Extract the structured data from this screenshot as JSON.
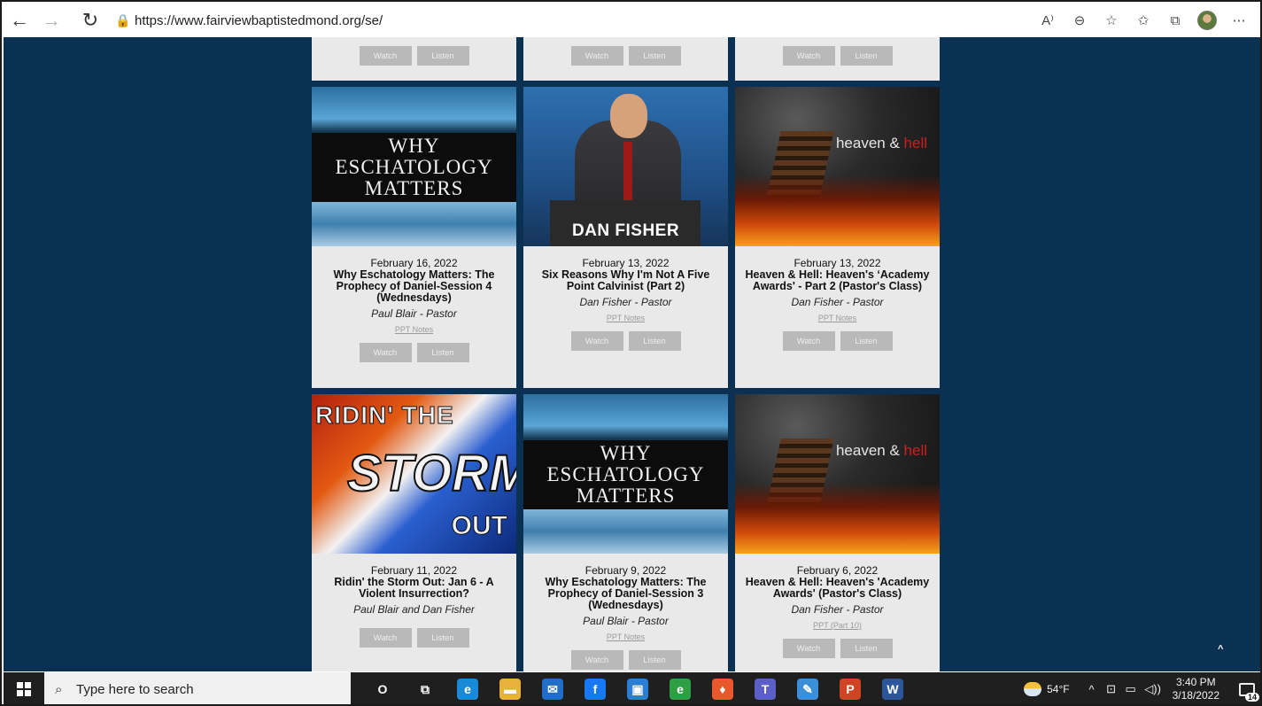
{
  "browser": {
    "url": "https://www.fairviewbaptistedmond.org/se/",
    "back_icon": "←",
    "forward_icon": "→",
    "refresh_icon": "↻",
    "lock_icon": "🔒",
    "toolbar_icons": [
      "read-aloud-icon",
      "zoom-icon",
      "add-favorite-icon",
      "favorites-icon",
      "collections-icon",
      "profile-icon",
      "more-icon"
    ],
    "read_aloud_glyph": "A⁾",
    "zoom_glyph": "⊖",
    "add_favorite_glyph": "☆",
    "favorites_glyph": "✩",
    "collections_glyph": "⧉",
    "more_glyph": "⋯"
  },
  "page": {
    "watch_label": "Watch",
    "listen_label": "Listen",
    "scroll_top_glyph": "^",
    "sermons": [
      {
        "thumb": "why-eschatology-matters",
        "thumb_text": [
          "WHY",
          "ESCHATOLOGY",
          "MATTERS"
        ],
        "date": "February 16, 2022",
        "title": "Why Eschatology Matters: The Prophecy of Daniel-Session 4 (Wednesdays)",
        "speaker": "Paul Blair - Pastor",
        "notes": "PPT Notes"
      },
      {
        "thumb": "dan-fisher",
        "thumb_text": [
          "DAN FISHER"
        ],
        "date": "February 13, 2022",
        "title": "Six Reasons Why I'm Not A Five Point Calvinist (Part 2)",
        "speaker": "Dan Fisher - Pastor",
        "notes": "PPT Notes"
      },
      {
        "thumb": "heaven-and-hell",
        "thumb_text": [
          "heaven &",
          "hell"
        ],
        "date": "February 13, 2022",
        "title": "Heaven & Hell: Heaven's ‘Academy Awards' - Part 2 (Pastor's Class)",
        "speaker": "Dan Fisher - Pastor",
        "notes": "PPT Notes"
      },
      {
        "thumb": "ridin-the-storm-out",
        "thumb_text": [
          "RIDIN' THE",
          "STORM",
          "OUT"
        ],
        "date": "February 11, 2022",
        "title": "Ridin' the Storm Out: Jan 6 - A Violent Insurrection?",
        "speaker": "Paul Blair and Dan Fisher",
        "notes": ""
      },
      {
        "thumb": "why-eschatology-matters",
        "thumb_text": [
          "WHY",
          "ESCHATOLOGY",
          "MATTERS"
        ],
        "date": "February 9, 2022",
        "title": "Why Eschatology Matters: The Prophecy of Daniel-Session 3 (Wednesdays)",
        "speaker": "Paul Blair - Pastor",
        "notes": "PPT Notes"
      },
      {
        "thumb": "heaven-and-hell",
        "thumb_text": [
          "heaven &",
          "hell"
        ],
        "date": "February 6, 2022",
        "title": "Heaven & Hell: Heaven's 'Academy Awards' (Pastor's Class)",
        "speaker": "Dan Fisher - Pastor",
        "notes": "PPT (Part 10)"
      }
    ]
  },
  "taskbar": {
    "search_placeholder": "Type here to search",
    "search_glyph": "⌕",
    "apps": [
      {
        "name": "cortana-icon",
        "glyph": "O",
        "color": "#1f1f1f"
      },
      {
        "name": "task-view-icon",
        "glyph": "⧉",
        "color": "#1f1f1f"
      },
      {
        "name": "edge-icon",
        "glyph": "e",
        "color": "#1a8ad6"
      },
      {
        "name": "file-explorer-icon",
        "glyph": "▬",
        "color": "#e8b13a"
      },
      {
        "name": "mail-icon",
        "glyph": "✉",
        "color": "#1f6fc9"
      },
      {
        "name": "facebook-icon",
        "glyph": "f",
        "color": "#1877f2"
      },
      {
        "name": "store-icon",
        "glyph": "▣",
        "color": "#2a7fd4"
      },
      {
        "name": "edge-dev-icon",
        "glyph": "e",
        "color": "#2ea043"
      },
      {
        "name": "brave-icon",
        "glyph": "♦",
        "color": "#e8582b"
      },
      {
        "name": "teams-icon",
        "glyph": "T",
        "color": "#5b5fc7"
      },
      {
        "name": "notes-icon",
        "glyph": "✎",
        "color": "#3b8fd9"
      },
      {
        "name": "powerpoint-icon",
        "glyph": "P",
        "color": "#d04423"
      },
      {
        "name": "word-icon",
        "glyph": "W",
        "color": "#2b579a"
      }
    ],
    "temperature": "54°F",
    "time": "3:40 PM",
    "date": "3/18/2022",
    "notification_count": "14",
    "chevron_glyph": "^",
    "network_glyph": "⊡",
    "battery_glyph": "▭",
    "volume_glyph": "◁))"
  }
}
